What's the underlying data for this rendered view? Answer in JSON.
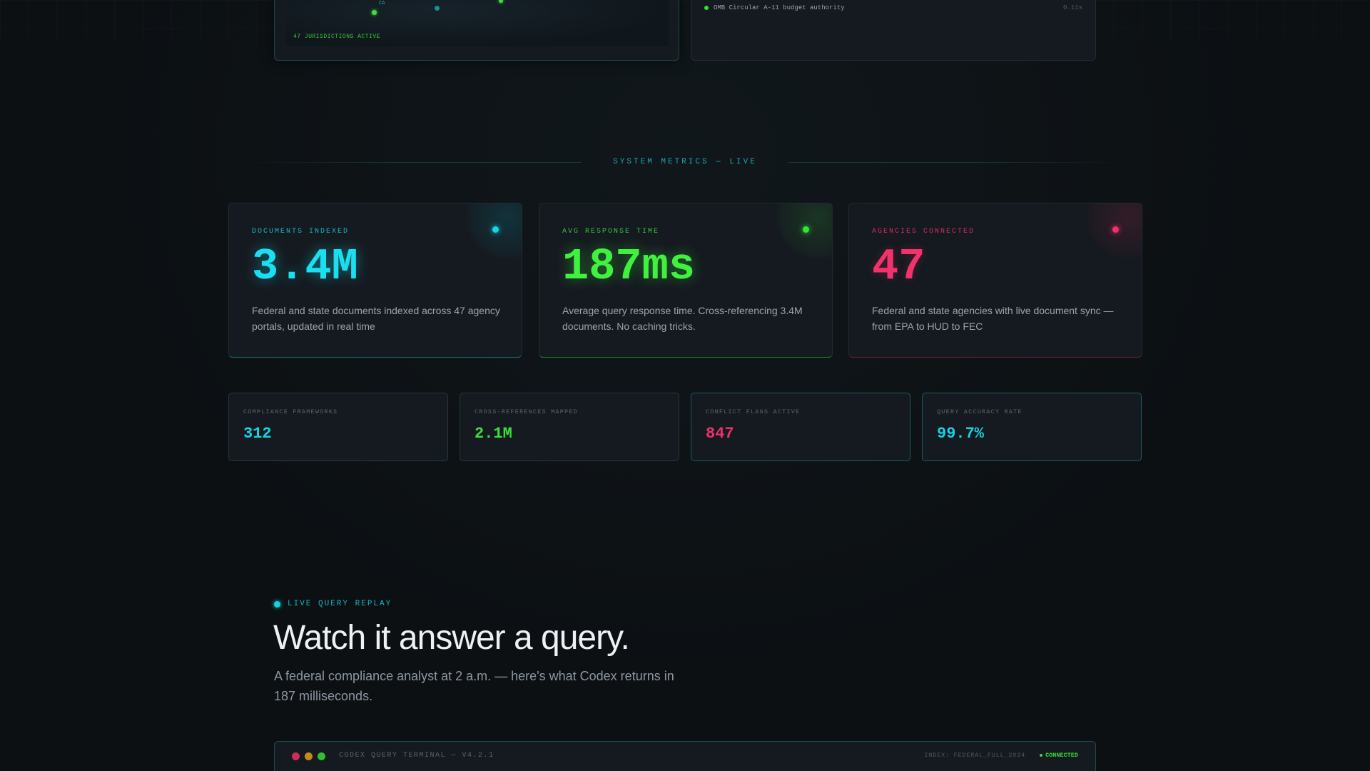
{
  "map_panel": {
    "jurisdictions_label": "47 JURISDICTIONS ACTIVE",
    "state_label": "CA"
  },
  "authority_panel": {
    "row_text": "OMB Circular A-11 budget authority",
    "row_time": "0.11s"
  },
  "metrics_section": {
    "heading": "SYSTEM METRICS — LIVE"
  },
  "metric_cards": [
    {
      "label": "DOCUMENTS INDEXED",
      "value": "3.4M",
      "description": "Federal and state documents indexed across 47 agency portals, updated in real time"
    },
    {
      "label": "AVG RESPONSE TIME",
      "value": "187ms",
      "description": "Average query response time. Cross-referencing 3.4M documents. No caching tricks."
    },
    {
      "label": "AGENCIES CONNECTED",
      "value": "47",
      "description": "Federal and state agencies with live document sync — from EPA to HUD to FEC"
    }
  ],
  "stat_cards": [
    {
      "label": "COMPLIANCE FRAMEWORKS",
      "value": "312"
    },
    {
      "label": "CROSS-REFERENCES MAPPED",
      "value": "2.1M"
    },
    {
      "label": "CONFLICT FLAGS ACTIVE",
      "value": "847"
    },
    {
      "label": "QUERY ACCURACY RATE",
      "value": "99.7%"
    }
  ],
  "replay_section": {
    "eyebrow": "LIVE QUERY REPLAY",
    "title": "Watch it answer a query.",
    "subtitle": "A federal compliance analyst at 2 a.m. — here's what Codex returns in 187 milliseconds."
  },
  "terminal": {
    "title": "CODEX QUERY TERMINAL — V4.2.1",
    "index": "INDEX: FEDERAL_FULL_2024",
    "status": "CONNECTED"
  },
  "colors": {
    "background": "#0c1013",
    "cyan": "#19dff0",
    "green": "#3ef23e",
    "pink": "#f3316d",
    "card": "#151a20"
  }
}
